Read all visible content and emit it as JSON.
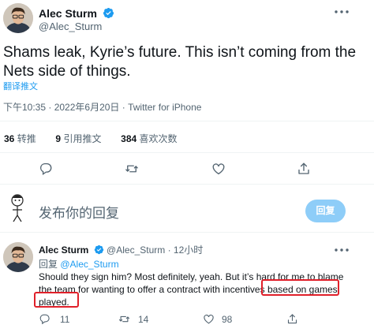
{
  "main_tweet": {
    "author_name": "Alec Sturm",
    "author_handle": "@Alec_Sturm",
    "text_line1": "Shams leak, Kyrie’s future. This isn’t coming from the",
    "text_line2": "Nets side of things.",
    "translate_label": "翻译推文",
    "timestamp": "下午10:35 · 2022年6月20日 · Twitter for iPhone",
    "stats": {
      "retweets_count": "36",
      "retweets_label": "转推",
      "quotes_count": "9",
      "quotes_label": "引用推文",
      "likes_count": "384",
      "likes_label": "喜欢次数"
    }
  },
  "reply_composer": {
    "placeholder": "发布你的回复",
    "button_label": "回复"
  },
  "reply_tweet": {
    "author_name": "Alec Sturm",
    "author_handle": "@Alec_Sturm",
    "time": "· 12小时",
    "replying_prefix": "回复",
    "replying_to": "@Alec_Sturm",
    "text_line1": "Should they sign him? Most definitely, yeah. But it’s hard for me to blame",
    "text_line2": "the team for wanting to offer a contract with incentives",
    "text_line2_highlight": "based on games",
    "text_line3": "played.",
    "reply_count": "11",
    "retweet_count": "14",
    "like_count": "98"
  },
  "colors": {
    "accent": "#1d9bf0",
    "highlight_box": "#e0202a",
    "reply_button_bg": "#8ecdf8"
  },
  "icons": [
    "verified-badge-icon",
    "more-options-icon",
    "reply-icon",
    "retweet-icon",
    "like-icon",
    "share-icon"
  ]
}
